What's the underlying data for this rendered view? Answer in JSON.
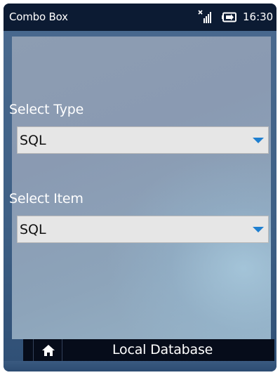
{
  "status_bar": {
    "title": "Combo Box",
    "time": "16:30",
    "signal_icon": "signal-icon",
    "battery_icon": "battery-charging-icon"
  },
  "form": {
    "type": {
      "label": "Select Type",
      "selected": "SQL"
    },
    "item": {
      "label": "Select Item",
      "selected": "SQL"
    }
  },
  "bottom_bar": {
    "title": "Local Database",
    "home_icon": "home-icon"
  },
  "colors": {
    "status_bar_bg": "#0c1b33",
    "accent_arrow": "#1e7fd0",
    "combo_bg": "#e6e6e6"
  }
}
